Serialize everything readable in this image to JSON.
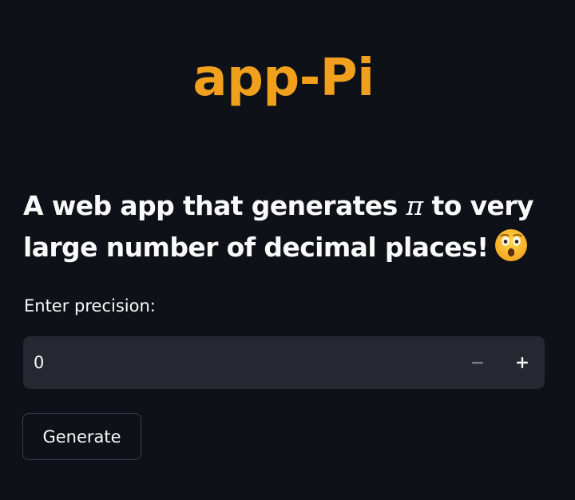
{
  "header": {
    "title": "app-Pi"
  },
  "intro": {
    "text_before_pi": "A web app that generates ",
    "pi_symbol": "π",
    "text_after_pi": " to very large number of decimal places!",
    "emoji_icon": "astonished-face-icon"
  },
  "precision_input": {
    "label": "Enter precision:",
    "value": "0",
    "decrement_icon": "minus-icon",
    "increment_icon": "plus-icon"
  },
  "actions": {
    "generate_label": "Generate"
  },
  "colors": {
    "background": "#0e1117",
    "title": "#f1a01e",
    "text": "#fafafa",
    "input_background": "#262730",
    "button_border": "#3d3f4a"
  }
}
